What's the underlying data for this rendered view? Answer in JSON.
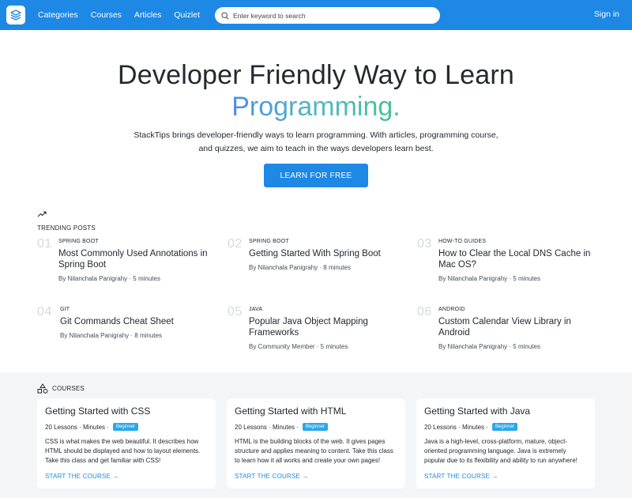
{
  "nav": {
    "links": [
      "Categories",
      "Courses",
      "Articles",
      "Quizlet"
    ],
    "search_placeholder": "Enter keyword to search",
    "signin": "Sign in"
  },
  "hero": {
    "title": "Developer Friendly Way to Learn",
    "accent": "Programming.",
    "description": "StackTips brings developer-friendly ways to learn programming. With articles, programming course, and quizzes, we aim to teach in the ways developers learn best.",
    "cta": "LEARN FOR FREE"
  },
  "trending": {
    "heading": "TRENDING POSTS",
    "posts": [
      {
        "num": "01",
        "tag": "SPRING BOOT",
        "title": "Most Commonly Used Annotations in Spring Boot",
        "meta": "By Nilanchala Panigrahy · 5 minutes"
      },
      {
        "num": "02",
        "tag": "SPRING BOOT",
        "title": "Getting Started With Spring Boot",
        "meta": "By Nilanchala Panigrahy · 8 minutes"
      },
      {
        "num": "03",
        "tag": "HOW-TO GUIDES",
        "title": "How to Clear the Local DNS Cache in Mac OS?",
        "meta": "By Nilanchala Panigrahy · 5 minutes"
      },
      {
        "num": "04",
        "tag": "GIT",
        "title": "Git Commands Cheat Sheet",
        "meta": "By Nilanchala Panigrahy · 8 minutes"
      },
      {
        "num": "05",
        "tag": "JAVA",
        "title": "Popular Java Object Mapping Frameworks",
        "meta": "By Community Member · 5 minutes"
      },
      {
        "num": "06",
        "tag": "ANDROID",
        "title": "Custom Calendar View Library in Android",
        "meta": "By Nilanchala Panigrahy · 5 minutes"
      }
    ]
  },
  "courses": {
    "heading": "COURSES",
    "items": [
      {
        "title": "Getting Started with CSS",
        "lessons": "20 Lessons · Minutes ·",
        "badge": "Beginner",
        "description": "CSS is what makes the web beautiful. It describes how HTML should be displayed and how to layout elements. Take this class and get familiar with CSS!",
        "link": "START THE COURSE →"
      },
      {
        "title": "Getting Started with HTML",
        "lessons": "20 Lessons · Minutes ·",
        "badge": "Beginner",
        "description": "HTML is the building blocks of the web. It gives pages structure and applies meaning to content. Take this class to learn how it all works and create your own pages!",
        "link": "START THE COURSE →"
      },
      {
        "title": "Getting Started with Java",
        "lessons": "20 Lessons · Minutes ·",
        "badge": "Beginner",
        "description": "Java is a high-level, cross-platform, mature, object-oriented programming language. Java is extremely popular due to its flexibility and ability to run anywhere!",
        "link": "START THE COURSE →"
      }
    ]
  },
  "colors": {
    "brand": "#1e88e5",
    "badge": "#2aa8e6"
  }
}
